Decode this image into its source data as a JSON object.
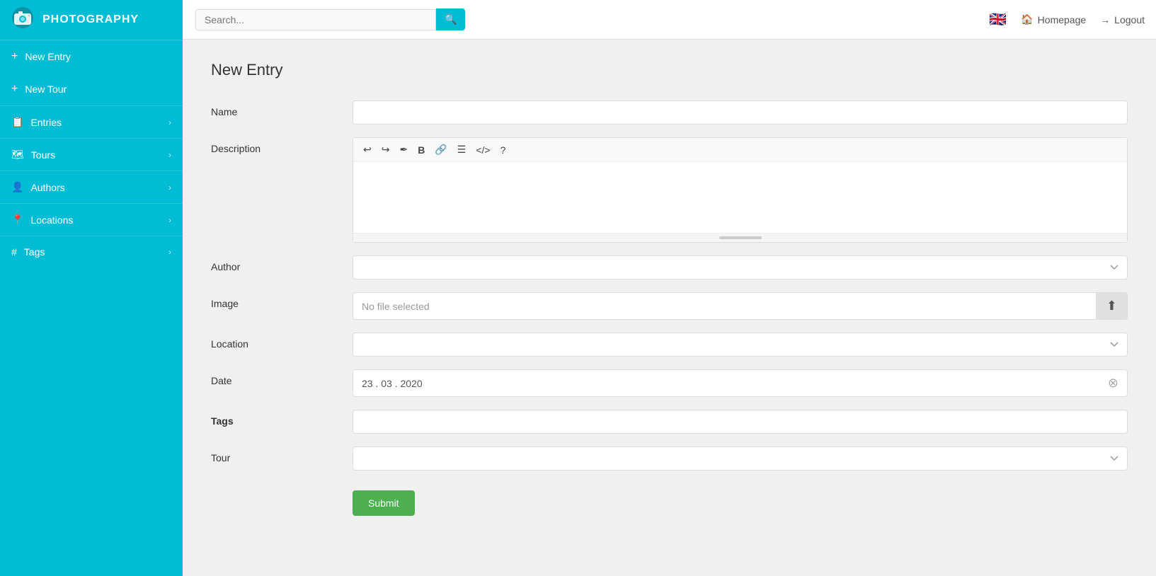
{
  "brand": {
    "name": "PHOTOGRAPHY",
    "icon": "📷"
  },
  "navbar": {
    "search_placeholder": "Search...",
    "homepage_label": "Homepage",
    "logout_label": "Logout",
    "flag": "🇬🇧"
  },
  "sidebar": {
    "new_entry_label": "New Entry",
    "new_tour_label": "New Tour",
    "items": [
      {
        "id": "entries",
        "label": "Entries",
        "icon": "📋"
      },
      {
        "id": "tours",
        "label": "Tours",
        "icon": "🗺"
      },
      {
        "id": "authors",
        "label": "Authors",
        "icon": "👤"
      },
      {
        "id": "locations",
        "label": "Locations",
        "icon": "📍"
      },
      {
        "id": "tags",
        "label": "Tags",
        "icon": "#"
      }
    ]
  },
  "page": {
    "title": "New Entry",
    "form": {
      "name_label": "Name",
      "name_value": "",
      "description_label": "Description",
      "author_label": "Author",
      "image_label": "Image",
      "image_placeholder": "No file selected",
      "location_label": "Location",
      "date_label": "Date",
      "date_value": "23 . 03 . 2020",
      "tags_label": "Tags",
      "tour_label": "Tour",
      "submit_label": "Submit"
    },
    "editor_toolbar": {
      "undo": "↩",
      "redo": "↪",
      "eraser": "🖊",
      "bold": "B",
      "link": "🔗",
      "list": "☰",
      "code": "</>",
      "help": "?"
    }
  }
}
